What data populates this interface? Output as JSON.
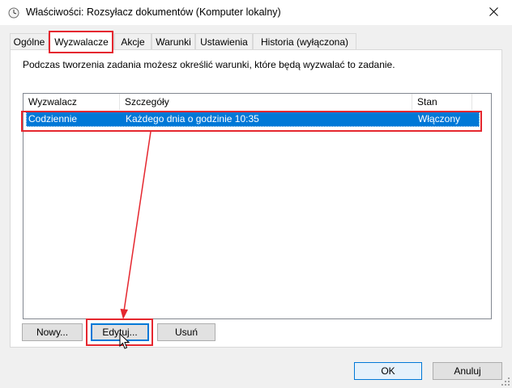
{
  "window": {
    "title": "Właściwości: Rozsyłacz dokumentów (Komputer lokalny)"
  },
  "tabs": [
    {
      "label": "Ogólne"
    },
    {
      "label": "Wyzwalacze",
      "selected": true
    },
    {
      "label": "Akcje"
    },
    {
      "label": "Warunki"
    },
    {
      "label": "Ustawienia"
    },
    {
      "label": "Historia (wyłączona)"
    }
  ],
  "panel": {
    "instruction": "Podczas tworzenia zadania możesz określić warunki, które będą wyzwalać to zadanie."
  },
  "triggers": {
    "columns": [
      "Wyzwalacz",
      "Szczegóły",
      "Stan"
    ],
    "rows": [
      {
        "trigger": "Codziennie",
        "details": "Każdego dnia o godzinie 10:35",
        "status": "Włączony",
        "selected": true
      }
    ]
  },
  "buttons": {
    "new": "Nowy...",
    "edit": "Edytuj...",
    "delete": "Usuń",
    "ok": "OK",
    "cancel": "Anuluj"
  },
  "colors": {
    "selection": "#0078d7",
    "highlight": "#e5272f",
    "window_bg": "#f0f0f0"
  },
  "icons": {
    "title": "clock-icon",
    "close": "close-icon",
    "cursor": "mouse-pointer-icon"
  }
}
